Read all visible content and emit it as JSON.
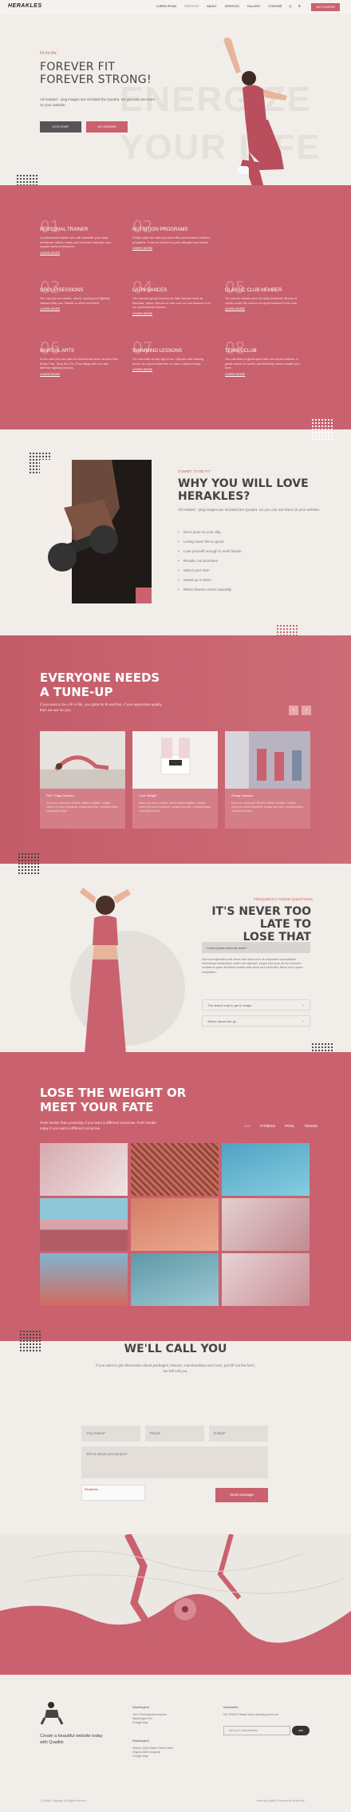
{
  "brand": {
    "logo": "HERAKLES",
    "accent": "#c9626e"
  },
  "nav": {
    "items": [
      "Lorem ipsum",
      "Services",
      "About",
      "Services",
      "Gallery",
      "Contact"
    ],
    "cta": "Get Started"
  },
  "hero": {
    "kicker": "Fit for life.",
    "title_line1": "FOREVER FIT",
    "title_line2": "FOREVER STRONG!",
    "text": "All isolated - ying images are included the Quadra. So you can use them on your website.",
    "btn_primary": "Lets start",
    "btn_secondary": "My lessons",
    "bg_word1": "ENERGIZE",
    "bg_word2": "YOUR LIFE"
  },
  "services": [
    {
      "num": "01",
      "title": "Personal Trainer",
      "text": "A professional trainer who will calculate your daily nutritional values, loads and exercises and give you regular workout sessions.",
      "more": "Learn more"
    },
    {
      "num": "02",
      "title": "Nutrition Programs",
      "text": "Easily make the diet you want with personalized nutrition programs. It can be tailored to your allergies and tastes.",
      "more": "Learn more"
    },
    {
      "num": "",
      "title": "",
      "text": "",
      "more": ""
    },
    {
      "num": "03",
      "title": "Group Sessions",
      "text": "You can join our cardio, dance, cycling and fighting classes with your friends or other members.",
      "more": "Learn more"
    },
    {
      "num": "04",
      "title": "Latin Dances",
      "text": "You can join group lessons for latin dances such as Bachata, Salsa, Rumba or take one-on-one lessons from our professional trainers.",
      "more": "Learn more"
    },
    {
      "num": "05",
      "title": "Classic Club Member",
      "text": "You can do classic such as daily workouts, fitness or cardio under the control of expert trainers in the club.",
      "more": "Learn more"
    },
    {
      "num": "06",
      "title": "Martial Arts",
      "text": "In the club you can train for martial arts such as Kick Box, Muay Thai, Tang Soo Do, Krav Maga with our self-defense fighting lessons.",
      "more": "Learn more"
    },
    {
      "num": "07",
      "title": "Swimming Lessons",
      "text": "You can train at any age in our Olympic and training pools, be a good swimmer or have a perfect body.",
      "more": "Learn more"
    },
    {
      "num": "08",
      "title": "Tennis Club",
      "text": "You can learn a great sport with our expert trainers. A great choice for cardio and flexibility, tennis awaits you here.",
      "more": "Learn more"
    }
  ],
  "why": {
    "kicker": "Commit to be fit",
    "title_line1": "WHY YOU WILL LOVE",
    "title_line2": "HERAKLES?",
    "text": "All isolated - ying images are included the Quadra. So you can use them on your website.",
    "list": [
      "Get a jump on your day.",
      "Losing never felt so good.",
      "Love yourself enough to work harder.",
      "Results, not promises.",
      "Select your size!",
      "Sweat up a storm.",
      "Where fitness comes naturally."
    ]
  },
  "tuneup": {
    "title_line1": "EVERYONE NEEDS",
    "title_line2": "A TUNE-UP",
    "text": "If you want to be a fit in life, you gotta be fit and fine. If you appreciate quality, then we are for you.",
    "prev": "‹",
    "next": "›",
    "cards": [
      {
        "title": "Fat 1 Yoga Classes",
        "text": "Ut et nec commodo ellorem, finibus sodales. Integer viverra et lorem hendrerit, cursus sem sed, volutpat metus commodo lectus."
      },
      {
        "title": "Lose Weight",
        "text": "Nunc nec nunc porttitor, finibus quam sodales. Integer viverra et lorem hendrerit, cursus sem sed, volutpat metus commodo lectus."
      },
      {
        "title": "Group Lessons",
        "text": "Ut et nec commodo ellorem, finibus sodales. Integer viverra et lorem hendrerit, cursus sem sed, volutpat metus commodo lectus."
      }
    ]
  },
  "faq": {
    "kicker": "Frequently asked questions",
    "title_line1": "IT'S NEVER TOO LATE TO",
    "title_line2": "LOSE THAT WEIGHT.",
    "open_q": "Lorem ipsum dolor sit amet?",
    "answer": "Sed ut perspiciatis unde omnis iste natus error sit voluptatem accusantium doloremque laudantium, totam rem aperiam, eaque ipsa quae ab illo inventore veritatis et quasi architecto beatae vitae dicta sunt explicabo. Nemo enim ipsam voluptatem.",
    "q2": "The fastest way to get in shape",
    "q3": "Where dance the go"
  },
  "gallery": {
    "title_line1": "LOSE THE WEIGHT OR",
    "title_line2": "MEET YOUR FATE",
    "text": "Push harder than yesterday if you want a different tomorrow. Push harder today if you want a different tomorrow.",
    "filters": [
      "All",
      "Fitness",
      "Pool",
      "Tennis"
    ]
  },
  "contact": {
    "title": "WE'LL CALL YOU",
    "text": "If you want to get information about packages, lessons, memberships and more, just fill out the form, we will call you.",
    "name_ph": "Your Name*",
    "phone_ph": "Phone",
    "email_ph": "E-Mail*",
    "message_ph": "Tell us about your project*",
    "captcha": "Recaptcha",
    "send": "Send message"
  },
  "footer": {
    "tagline": "Create a beautiful website today with Qualitis",
    "col1_title": "Washington",
    "col1_text": "1512 Pennsylvania Avenue\nWashington DC\nGoogle Map",
    "col2_title": "Washington",
    "col2_text": "Shirley 3456 Sutton Street West\nVirginia 5800 Augusta\nGoogle Map",
    "news_title": "Newsletter",
    "news_text": "NO SPAM! Please check already joined us!",
    "news_ph": "Join our E-Mail Address",
    "news_btn": "Join",
    "copyright": "© Qualitis Copyright. All Rights Reserved.",
    "credits": "Theme by Qualitis | Powered by WordPress"
  }
}
